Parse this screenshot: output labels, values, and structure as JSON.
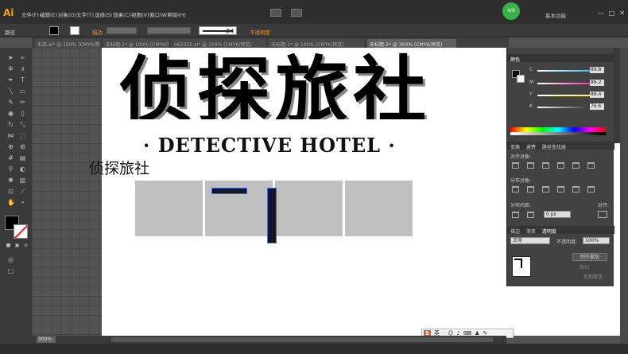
{
  "app": {
    "logo": "Ai",
    "menu": [
      "文件(F)",
      "编辑(E)",
      "对象(O)",
      "文字(T)",
      "选择(S)",
      "效果(C)",
      "视图(V)",
      "窗口(W)",
      "帮助(H)"
    ],
    "notify_badge": "4/9",
    "workspace": "基本功能",
    "window_controls": [
      "—",
      "□",
      "✕"
    ]
  },
  "control_bar": {
    "selection_label": "路径",
    "stroke_label": "描边",
    "stroke_style": "基本",
    "opacity_label": "不透明度"
  },
  "tabs": [
    {
      "label": "形态.ai* @ 150% (CMYK/预览)",
      "active": false
    },
    {
      "label": "未标题-1* @ 100% (CMYK/预览)",
      "active": false
    },
    {
      "label": "062332.ai* @ 100% (CMYK/预览)",
      "active": false
    },
    {
      "label": "未标题-1* @ 100% (CMYK/预览)",
      "active": false
    },
    {
      "label": "未标题-2* @ 300% (CMYK/预览)",
      "active": true
    }
  ],
  "canvas": {
    "big_title": "侦探旅社",
    "english_title": "· DETECTIVE HOTEL ·",
    "small_title": "侦探旅社"
  },
  "status": {
    "zoom": "300%"
  },
  "ime": {
    "logo": "S",
    "mode": "英"
  },
  "panels": {
    "color": {
      "tab": "颜色",
      "rows": [
        {
          "letter": "C",
          "value": "89.8",
          "unit": "%",
          "color": "#00aeef"
        },
        {
          "letter": "M",
          "value": "86.2",
          "unit": "%",
          "color": "#ec008c"
        },
        {
          "letter": "Y",
          "value": "86.4",
          "unit": "%",
          "color": "#fff200"
        },
        {
          "letter": "K",
          "value": "76.6",
          "unit": "%",
          "color": "#000000"
        }
      ]
    },
    "align": {
      "tabs": [
        "变换",
        "对齐",
        "路径查找器"
      ],
      "align_objects": "对齐对象:",
      "distribute_objects": "分布对象:",
      "distribute_spacing": "分布间距:",
      "align_to": "对齐:",
      "spacing_value": "0 px"
    },
    "transparency": {
      "tabs": [
        "描边",
        "渐变",
        "透明度"
      ],
      "blend_mode": "正常",
      "opacity_label": "不透明度:",
      "opacity_value": "100%",
      "make_mask": "制作蒙版",
      "clip": "剪切",
      "invert_mask": "反相蒙版"
    }
  }
}
